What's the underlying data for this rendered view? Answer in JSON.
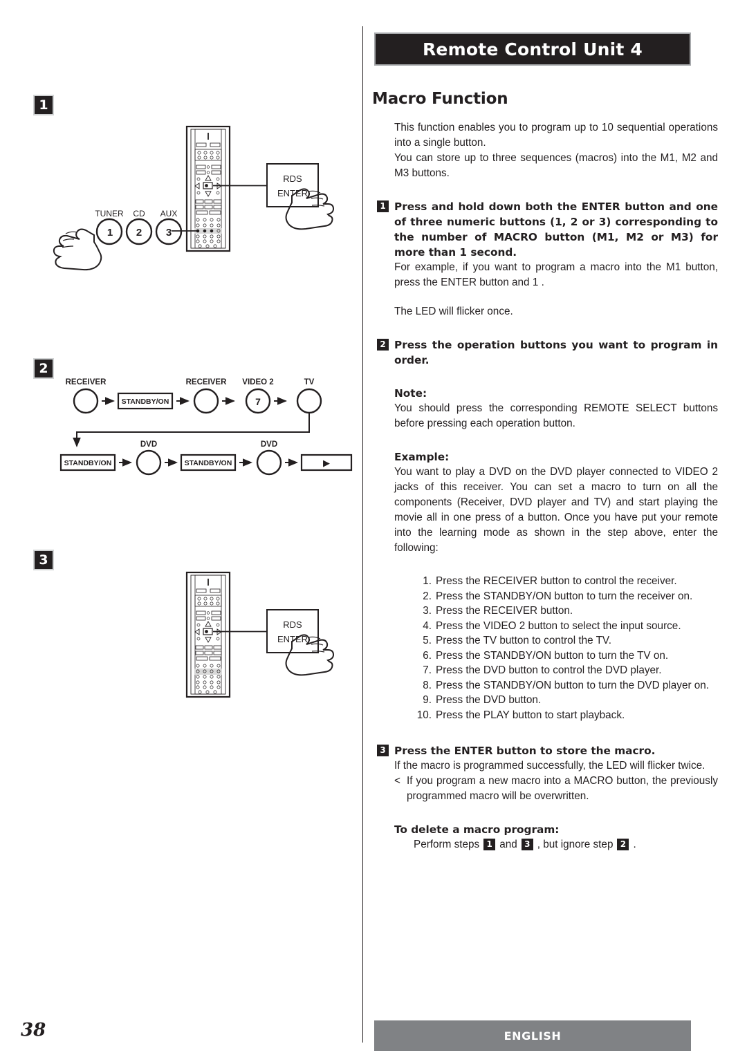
{
  "header": {
    "title": "Remote Control Unit 4"
  },
  "footer": {
    "page_number": "38",
    "language": "ENGLISH"
  },
  "main": {
    "section_title": "Macro Function",
    "intro_1": "This function enables you to program up to 10 sequential operations into a single button.",
    "intro_2": "You can store up to three sequences (macros) into the M1, M2 and M3 buttons.",
    "step1_num": "1",
    "step1_text": "Press and hold down both the ENTER button and one of three numeric buttons (1, 2 or 3) corresponding to the number of MACRO button (M1, M2 or M3) for more than 1 second.",
    "step1_body": "For example, if you want to program a macro into the M1 button, press the ENTER button and  1 .",
    "led_once": "The LED will flicker once.",
    "step2_num": "2",
    "step2_text": "Press the operation buttons you want to program in order.",
    "note_label": "Note:",
    "note_body": "You should press the corresponding REMOTE SELECT buttons before pressing each operation button.",
    "example_label": "Example:",
    "example_body": "You want to play a DVD on the DVD player connected to VIDEO 2 jacks of this receiver. You can set a macro to turn on all the components (Receiver, DVD player and TV) and start playing the movie all in one press of a button. Once you have put your remote into the learning mode as shown in the step above, enter the following:",
    "numbered_steps": [
      {
        "idx": "1.",
        "text": "Press the RECEIVER button to control the receiver."
      },
      {
        "idx": "2.",
        "text": "Press the STANDBY/ON button to turn the receiver on."
      },
      {
        "idx": "3.",
        "text": "Press the RECEIVER button."
      },
      {
        "idx": "4.",
        "text": "Press the VIDEO 2 button to select the input source."
      },
      {
        "idx": "5.",
        "text": "Press the TV button to control the TV."
      },
      {
        "idx": "6.",
        "text": "Press the STANDBY/ON button to turn the TV on."
      },
      {
        "idx": "7.",
        "text": "Press the DVD button to control the DVD player."
      },
      {
        "idx": "8.",
        "text": "Press the STANDBY/ON button to turn the DVD player on."
      },
      {
        "idx": "9.",
        "text": "Press the DVD button."
      },
      {
        "idx": "10.",
        "text": "Press the PLAY button to start playback."
      }
    ],
    "step3_num": "3",
    "step3_text": "Press the ENTER button to store the macro.",
    "step3_body": "If the macro is programmed successfully, the LED will flicker twice.",
    "bullet_marker": "<",
    "bullet_text": "If you program a new macro into a MACRO button, the previously programmed macro will be overwritten.",
    "delete_label": "To delete a macro program:",
    "delete_prefix": "Perform steps",
    "delete_a": "1",
    "delete_mid": "and",
    "delete_b": "3",
    "delete_mid2": ", but ignore step",
    "delete_c": "2",
    "delete_suffix": "."
  },
  "figures": {
    "fig1": {
      "marker": "1",
      "source_buttons": [
        {
          "label": "TUNER",
          "number": "1"
        },
        {
          "label": "CD",
          "number": "2"
        },
        {
          "label": "AUX",
          "number": "3"
        }
      ],
      "callout_line1": "RDS",
      "callout_line2": "ENTER"
    },
    "fig2": {
      "marker": "2",
      "row1": [
        {
          "kind": "circle",
          "label": "RECEIVER",
          "inner": ""
        },
        {
          "kind": "box",
          "label": "",
          "inner": "STANDBY/ON"
        },
        {
          "kind": "circle",
          "label": "RECEIVER",
          "inner": ""
        },
        {
          "kind": "circle",
          "label": "VIDEO 2",
          "inner": "7"
        },
        {
          "kind": "circle",
          "label": "TV",
          "inner": ""
        }
      ],
      "row2": [
        {
          "kind": "box",
          "label": "",
          "inner": "STANDBY/ON"
        },
        {
          "kind": "circle",
          "label": "DVD",
          "inner": ""
        },
        {
          "kind": "box",
          "label": "",
          "inner": "STANDBY/ON"
        },
        {
          "kind": "circle",
          "label": "DVD",
          "inner": ""
        },
        {
          "kind": "playbox",
          "label": "",
          "inner": "▶"
        }
      ]
    },
    "fig3": {
      "marker": "3",
      "callout_line1": "RDS",
      "callout_line2": "ENTER"
    }
  }
}
